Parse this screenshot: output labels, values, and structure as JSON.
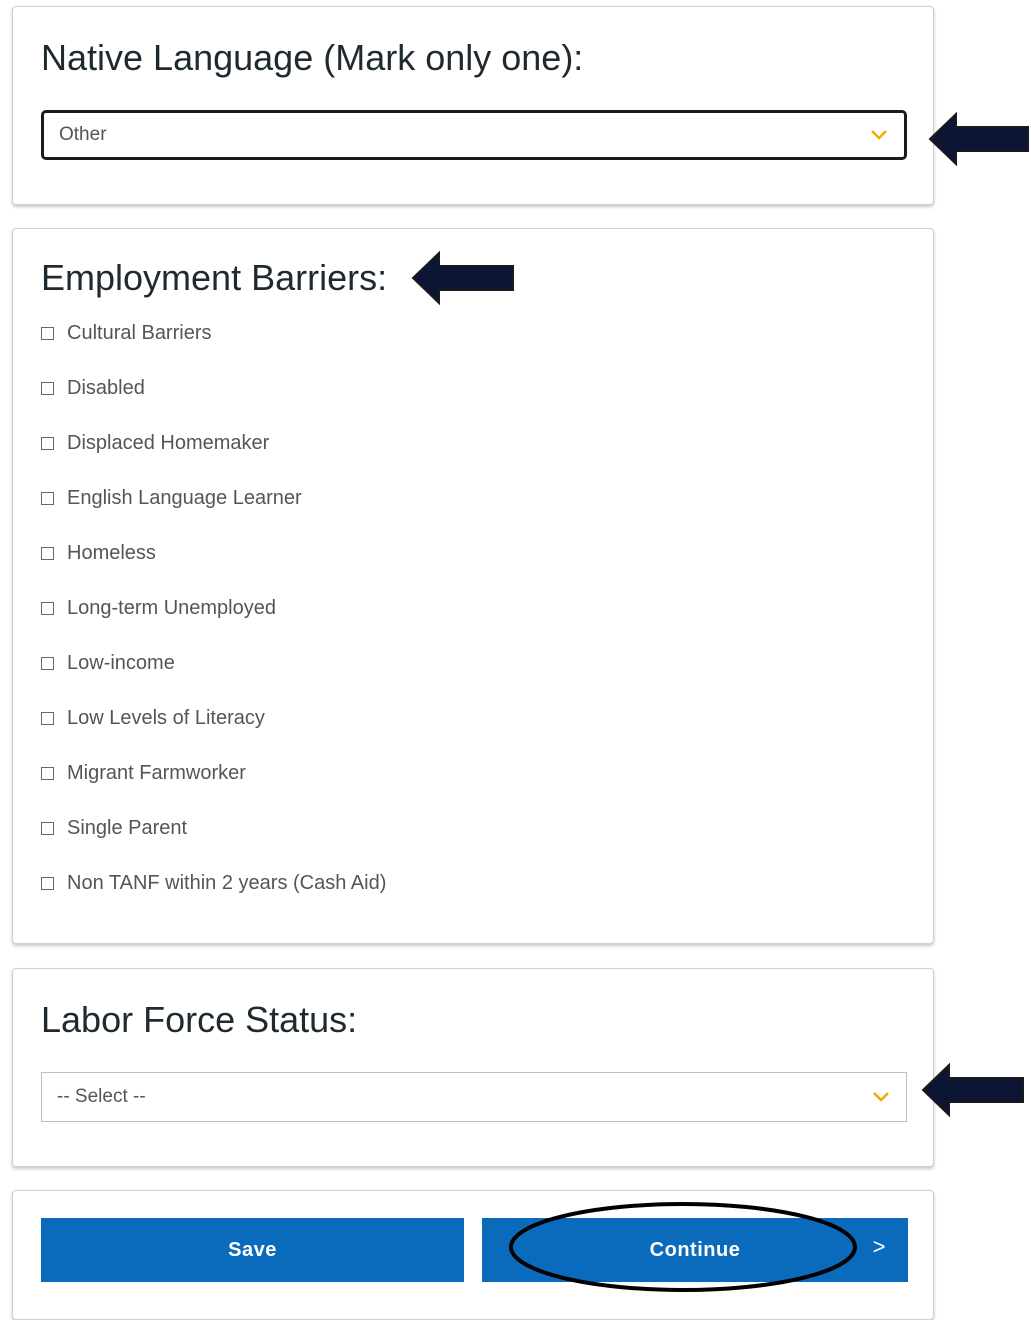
{
  "native_language": {
    "title": "Native Language (Mark only one):",
    "selected": "Other"
  },
  "employment_barriers": {
    "title": "Employment Barriers:",
    "options": [
      "Cultural Barriers",
      "Disabled",
      "Displaced Homemaker",
      "English Language Learner",
      "Homeless",
      "Long-term Unemployed",
      "Low-income",
      "Low Levels of Literacy",
      "Migrant Farmworker",
      "Single Parent",
      "Non TANF within 2 years (Cash Aid)"
    ]
  },
  "labor_force": {
    "title": "Labor Force Status:",
    "selected": "-- Select --"
  },
  "actions": {
    "save_label": "Save",
    "continue_label": "Continue",
    "continue_chevron": ">"
  },
  "colors": {
    "primary_button": "#0a6bbd",
    "chevron": "#f2a900",
    "annotation_arrow": "#0c1533"
  }
}
